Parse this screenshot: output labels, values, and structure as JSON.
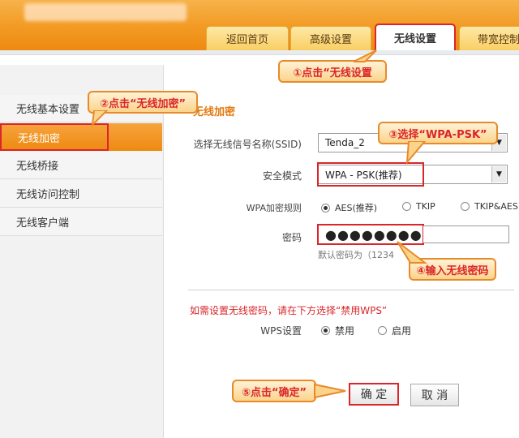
{
  "header": {
    "tabs": [
      {
        "label": "返回首页"
      },
      {
        "label": "高级设置"
      },
      {
        "label": "无线设置"
      },
      {
        "label": "带宽控制"
      }
    ]
  },
  "sidebar": {
    "items": [
      {
        "label": "无线基本设置"
      },
      {
        "label": "无线加密"
      },
      {
        "label": "无线桥接"
      },
      {
        "label": "无线访问控制"
      },
      {
        "label": "无线客户端"
      }
    ]
  },
  "main": {
    "section_title": "无线加密",
    "ssid_label": "选择无线信号名称(SSID)",
    "ssid_value": "Tenda_2",
    "security_label": "安全模式",
    "security_value": "WPA - PSK(推荐)",
    "wpa_rule_label": "WPA加密规则",
    "wpa_options": [
      "AES(推荐)",
      "TKIP",
      "TKIP&AES"
    ],
    "wpa_selected": "AES(推荐)",
    "password_label": "密码",
    "password_value": "●●●●●●●●",
    "password_hint": "默认密码为（1234",
    "wps_notice": "如需设置无线密码，请在下方选择“禁用WPS”",
    "wps_label": "WPS设置",
    "wps_options": [
      "禁用",
      "启用"
    ],
    "wps_selected": "禁用",
    "ok_button": "确 定",
    "cancel_button": "取 消"
  },
  "annotations": {
    "step1": "①点击“无线设置",
    "step2": "②点击“无线加密”",
    "step3": "③选择“WPA-PSK”",
    "step4": "④输入无线密码",
    "step5": "⑤点击“确定”"
  },
  "colors": {
    "header_orange": "#f29a22",
    "highlight_red": "#d9262a",
    "callout_fill": "#fbd48c"
  }
}
